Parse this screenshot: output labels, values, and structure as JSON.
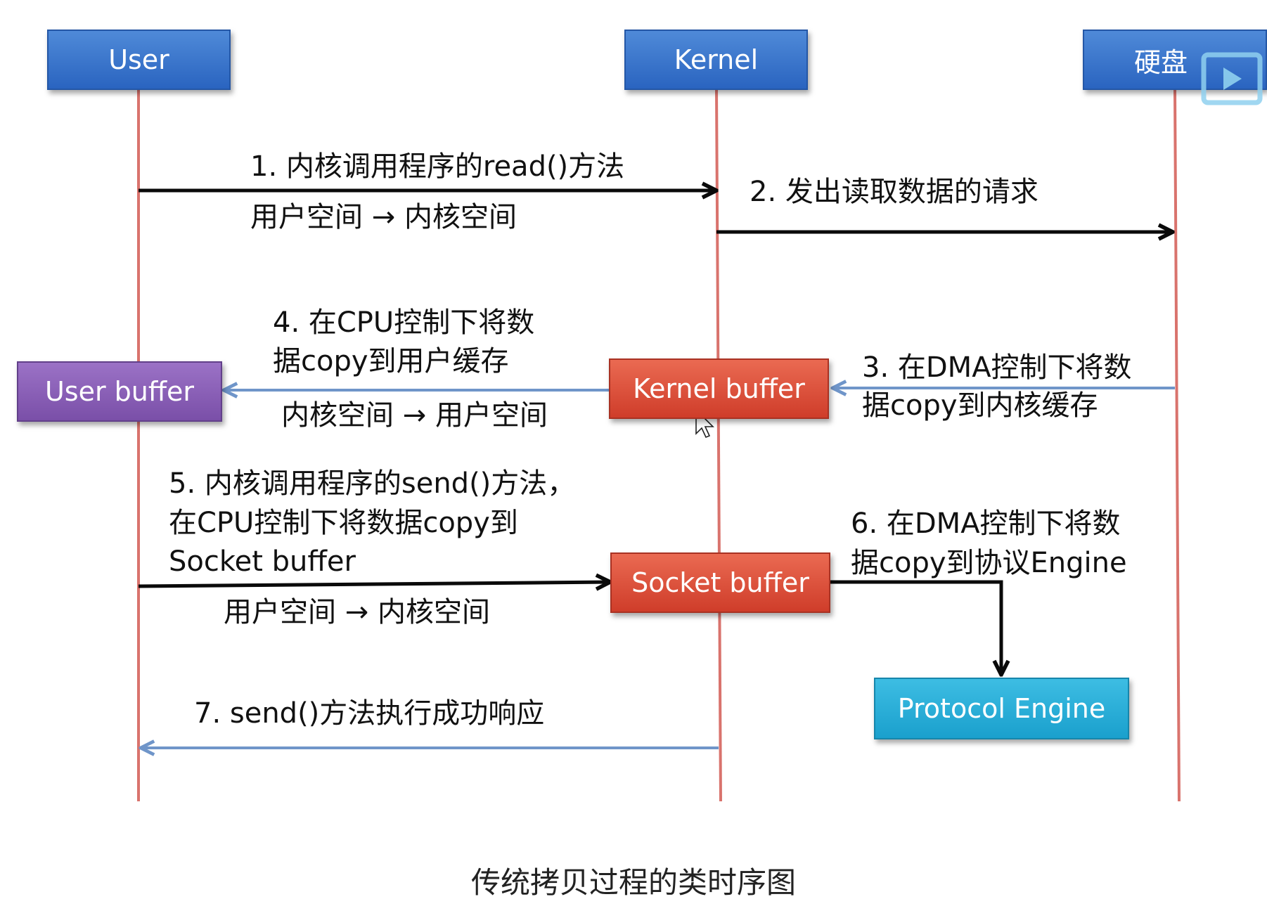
{
  "participants": {
    "user": "User",
    "kernel": "Kernel",
    "disk": "硬盘"
  },
  "buffers": {
    "user_buffer": "User buffer",
    "kernel_buffer": "Kernel buffer",
    "socket_buffer": "Socket buffer",
    "protocol_engine": "Protocol Engine"
  },
  "steps": {
    "s1": {
      "title": "1. 内核调用程序的read()方法",
      "sub": "用户空间 → 内核空间"
    },
    "s2": {
      "title": "2. 发出读取数据的请求"
    },
    "s3": {
      "line1": "3. 在DMA控制下将数",
      "line2": "据copy到内核缓存"
    },
    "s4": {
      "line1": "4. 在CPU控制下将数",
      "line2": "据copy到用户缓存",
      "sub": "内核空间 → 用户空间"
    },
    "s5": {
      "line1": "5. 内核调用程序的send()方法，",
      "line2": "在CPU控制下将数据copy到",
      "line3": "Socket buffer",
      "sub": "用户空间 → 内核空间"
    },
    "s6": {
      "line1": "6. 在DMA控制下将数",
      "line2": "据copy到协议Engine"
    },
    "s7": {
      "title": "7. send()方法执行成功响应"
    }
  },
  "caption": "传统拷贝过程的类时序图",
  "colors": {
    "lifeline": "#d9736d",
    "participant_box": "#3474cf",
    "user_buffer": "#8a5fb8",
    "kernel_buffer": "#e0503a",
    "protocol_engine": "#25aedb",
    "arrow_black": "#0a0a0a",
    "arrow_blue": "#6f95c9"
  }
}
